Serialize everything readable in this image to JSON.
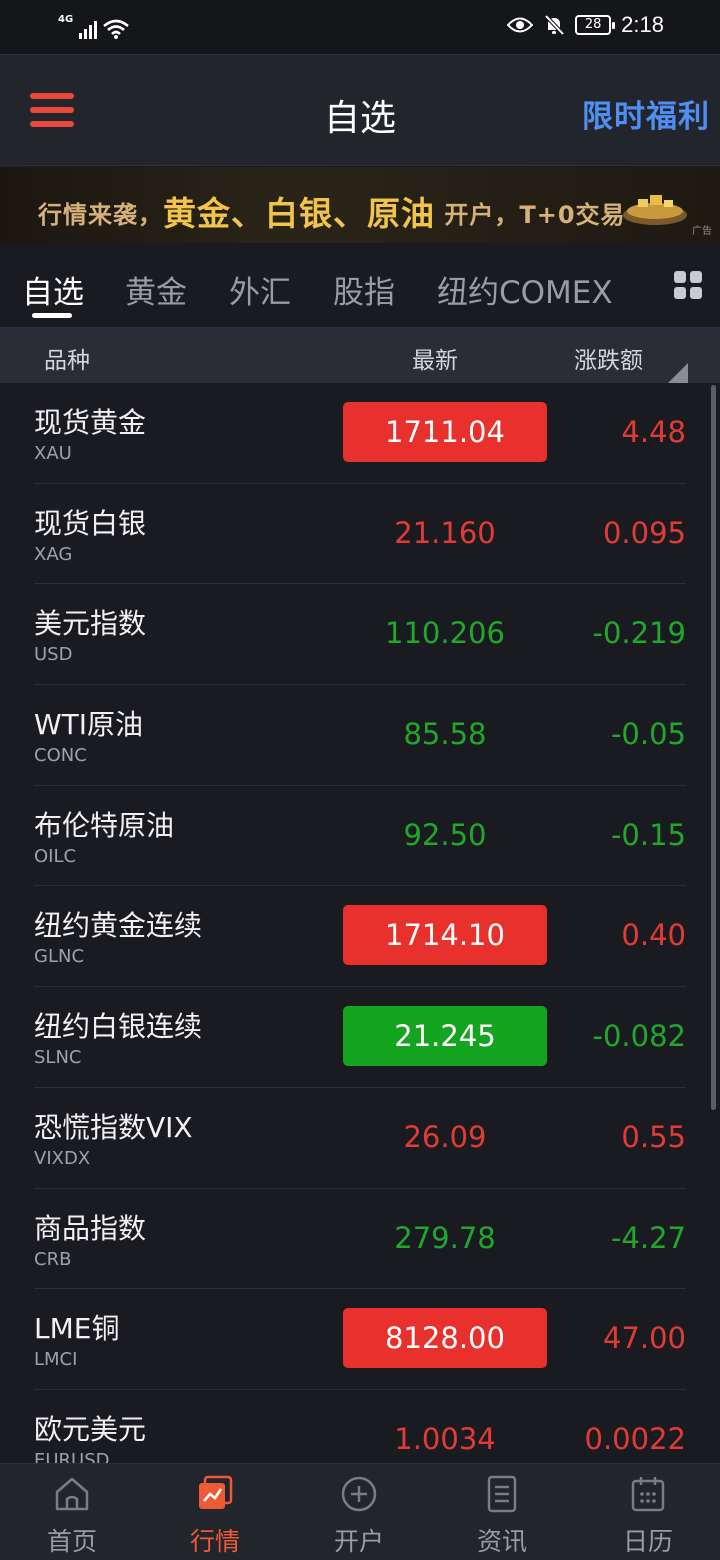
{
  "status_bar": {
    "network": "4G",
    "battery": "28",
    "time": "2:18"
  },
  "header": {
    "title": "自选",
    "promo": "限时福利"
  },
  "banner": {
    "pre": "行情来袭，",
    "highlight": "黄金、白银、原油",
    "post": "开户，T+0交易",
    "ad_tag": "广告"
  },
  "tabs": [
    {
      "label": "自选",
      "active": true
    },
    {
      "label": "黄金",
      "active": false
    },
    {
      "label": "外汇",
      "active": false
    },
    {
      "label": "股指",
      "active": false
    },
    {
      "label": "纽约COMEX",
      "active": false
    }
  ],
  "columns": {
    "name": "品种",
    "latest": "最新",
    "change": "涨跌额"
  },
  "rows": [
    {
      "name": "现货黄金",
      "code": "XAU",
      "price": "1711.04",
      "change": "4.48",
      "price_style": "box-up",
      "change_style": "up"
    },
    {
      "name": "现货白银",
      "code": "XAG",
      "price": "21.160",
      "change": "0.095",
      "price_style": "up",
      "change_style": "up"
    },
    {
      "name": "美元指数",
      "code": "USD",
      "price": "110.206",
      "change": "-0.219",
      "price_style": "down",
      "change_style": "down"
    },
    {
      "name": "WTI原油",
      "code": "CONC",
      "price": "85.58",
      "change": "-0.05",
      "price_style": "down",
      "change_style": "down"
    },
    {
      "name": "布伦特原油",
      "code": "OILC",
      "price": "92.50",
      "change": "-0.15",
      "price_style": "down",
      "change_style": "down"
    },
    {
      "name": "纽约黄金连续",
      "code": "GLNC",
      "price": "1714.10",
      "change": "0.40",
      "price_style": "box-up",
      "change_style": "up"
    },
    {
      "name": "纽约白银连续",
      "code": "SLNC",
      "price": "21.245",
      "change": "-0.082",
      "price_style": "box-down",
      "change_style": "down"
    },
    {
      "name": "恐慌指数VIX",
      "code": "VIXDX",
      "price": "26.09",
      "change": "0.55",
      "price_style": "up",
      "change_style": "up"
    },
    {
      "name": "商品指数",
      "code": "CRB",
      "price": "279.78",
      "change": "-4.27",
      "price_style": "down",
      "change_style": "down"
    },
    {
      "name": "LME铜",
      "code": "LMCI",
      "price": "8128.00",
      "change": "47.00",
      "price_style": "box-up",
      "change_style": "up"
    },
    {
      "name": "欧元美元",
      "code": "EURUSD",
      "price": "1.0034",
      "change": "0.0022",
      "price_style": "up",
      "change_style": "up"
    }
  ],
  "bottom_nav": [
    {
      "label": "首页",
      "icon": "home-icon",
      "active": false
    },
    {
      "label": "行情",
      "icon": "chart-icon",
      "active": true
    },
    {
      "label": "开户",
      "icon": "plus-circle-icon",
      "active": false
    },
    {
      "label": "资讯",
      "icon": "document-icon",
      "active": false
    },
    {
      "label": "日历",
      "icon": "calendar-icon",
      "active": false
    }
  ],
  "colors": {
    "up": "#e23b36",
    "down": "#1fa82a",
    "accent_nav": "#ef5a36",
    "promo_blue": "#4f8ff2",
    "menu_red": "#e8493a"
  }
}
